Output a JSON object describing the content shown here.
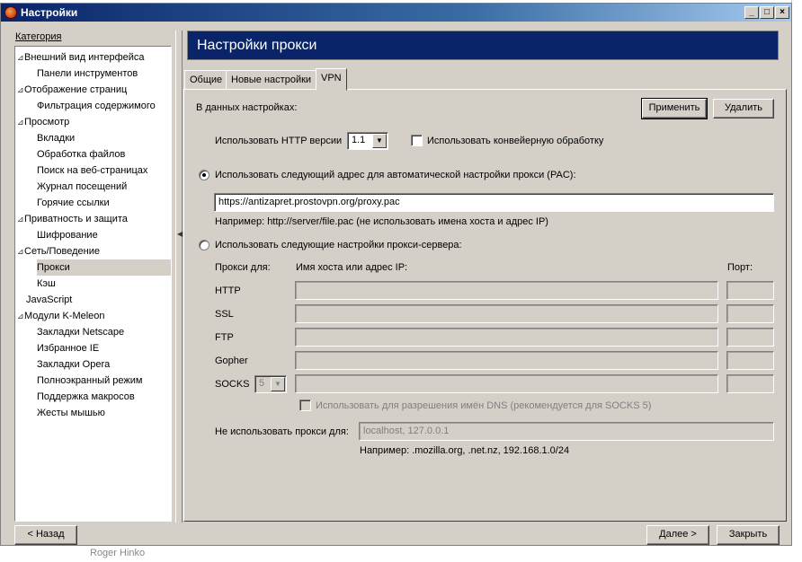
{
  "window": {
    "title": "Настройки",
    "minimize_glyph": "_",
    "maximize_glyph": "□",
    "close_glyph": "×"
  },
  "category": {
    "label": "Категория",
    "items": [
      {
        "label": "Внешний вид интерфейса",
        "level": 0,
        "expander": "⊿"
      },
      {
        "label": "Панели инструментов",
        "level": 1
      },
      {
        "label": "Отображение страниц",
        "level": 0,
        "expander": "⊿"
      },
      {
        "label": "Фильтрация содержимого",
        "level": 1
      },
      {
        "label": "Просмотр",
        "level": 0,
        "expander": "⊿"
      },
      {
        "label": "Вкладки",
        "level": 1
      },
      {
        "label": "Обработка файлов",
        "level": 1
      },
      {
        "label": "Поиск на веб-страницах",
        "level": 1
      },
      {
        "label": "Журнал посещений",
        "level": 1
      },
      {
        "label": "Горячие ссылки",
        "level": 1
      },
      {
        "label": "Приватность и защита",
        "level": 0,
        "expander": "⊿"
      },
      {
        "label": "Шифрование",
        "level": 1
      },
      {
        "label": "Сеть/Поведение",
        "level": 0,
        "expander": "⊿"
      },
      {
        "label": "Прокси",
        "level": 1,
        "selected": true
      },
      {
        "label": "Кэш",
        "level": 1
      },
      {
        "label": "JavaScript",
        "level": 0.5
      },
      {
        "label": "Модули K-Meleon",
        "level": 0,
        "expander": "⊿"
      },
      {
        "label": "Закладки Netscape",
        "level": 1
      },
      {
        "label": "Избранное IE",
        "level": 1
      },
      {
        "label": "Закладки Opera",
        "level": 1
      },
      {
        "label": "Полноэкранный режим",
        "level": 1
      },
      {
        "label": "Поддержка макросов",
        "level": 1
      },
      {
        "label": "Жесты мышью",
        "level": 1
      }
    ]
  },
  "panel": {
    "title": "Настройки прокси",
    "tabs": [
      {
        "label": "Общие"
      },
      {
        "label": "Новые настройки"
      },
      {
        "label": "VPN",
        "active": true
      }
    ]
  },
  "proxy": {
    "in_settings_label": "В данных настройках:",
    "apply_button": "Применить",
    "delete_button": "Удалить",
    "http_version_label": "Использовать HTTP версии",
    "http_version_value": "1.1",
    "pipelining_label": "Использовать конвейерную обработку",
    "pipelining_checked": false,
    "pac_radio_label": "Использовать следующий адрес для автоматической настройки прокси (PAC):",
    "pac_selected": true,
    "pac_url": "https://antizapret.prostovpn.org/proxy.pac",
    "pac_example": "Например: http://server/file.pac (не использовать имена хоста и адрес IP)",
    "manual_radio_label": "Использовать следующие настройки прокси-сервера:",
    "col_proxy_for": "Прокси для:",
    "col_host": "Имя хоста или адрес IP:",
    "col_port": "Порт:",
    "rows": [
      {
        "label": "HTTP"
      },
      {
        "label": "SSL"
      },
      {
        "label": "FTP"
      },
      {
        "label": "Gopher"
      },
      {
        "label": "SOCKS"
      }
    ],
    "socks_version": "5",
    "dns_label": "Использовать для разрешения имён DNS (рекомендуется для SOCKS 5)",
    "no_proxy_label": "Не использовать прокси для:",
    "no_proxy_value": "localhost, 127.0.0.1",
    "no_proxy_example": "Например: .mozilla.org, .net.nz, 192.168.1.0/24"
  },
  "footer": {
    "back_button": "< Назад",
    "next_button": "Далее >",
    "close_button": "Закрыть"
  },
  "background": {
    "peek_text": "Roger Hinko"
  }
}
